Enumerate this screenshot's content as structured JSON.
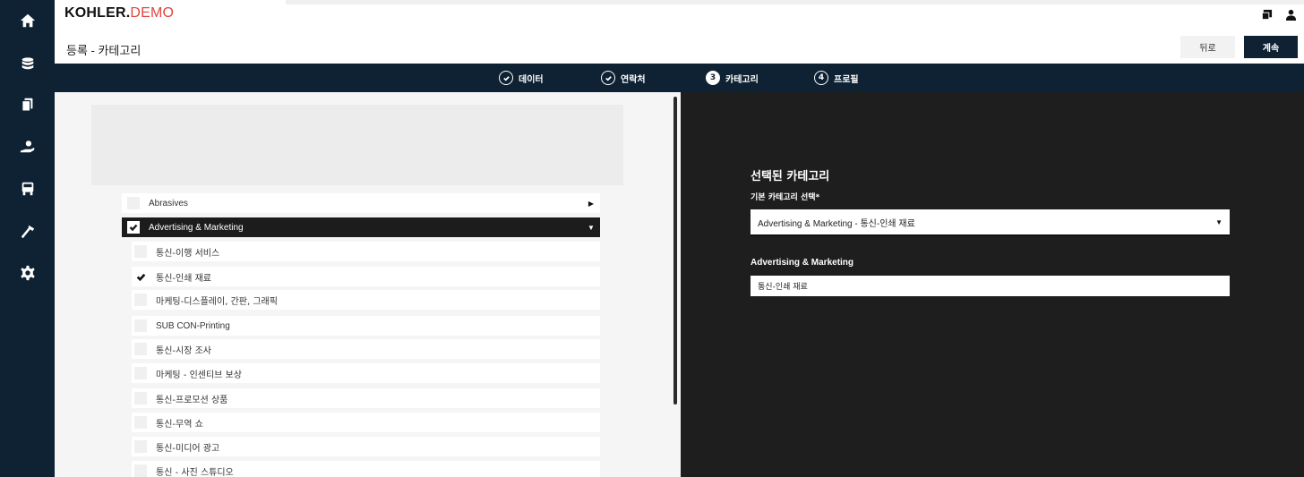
{
  "brand": {
    "bold": "KOHLER.",
    "light": "DEMO"
  },
  "header": {
    "title": "등록 - 카테고리",
    "back_label": "뒤로",
    "next_label": "계속"
  },
  "steps": [
    {
      "label": "데이터",
      "icon": "check-circle-icon"
    },
    {
      "label": "연락처",
      "icon": "check-circle-icon"
    },
    {
      "label": "카테고리",
      "number": "3",
      "active": true
    },
    {
      "label": "프로필",
      "number": "4"
    }
  ],
  "rail_icons": [
    "home-icon",
    "database-icon",
    "documents-icon",
    "hand-user-icon",
    "truck-icon",
    "hammer-icon",
    "gear-icon"
  ],
  "categories": {
    "parents": [
      {
        "label": "Abrasives",
        "checked": false,
        "expanded": false
      },
      {
        "label": "Advertising & Marketing",
        "checked": true,
        "expanded": true
      }
    ],
    "children": [
      {
        "label": "통신-이행 서비스",
        "checked": false
      },
      {
        "label": "통신-인쇄 재료",
        "checked": true
      },
      {
        "label": "마케팅-디스플레이, 간판, 그래픽",
        "checked": false
      },
      {
        "label": "SUB CON-Printing",
        "checked": false
      },
      {
        "label": "통신-시장 조사",
        "checked": false
      },
      {
        "label": "마케팅 - 인센티브 보상",
        "checked": false
      },
      {
        "label": "통신-프로모션 상품",
        "checked": false
      },
      {
        "label": "통신-무역 쇼",
        "checked": false
      },
      {
        "label": "통신-미디어 광고",
        "checked": false
      },
      {
        "label": "통신 - 사진 스튜디오",
        "checked": false
      }
    ]
  },
  "selected": {
    "heading": "선택된 카테고리",
    "primary_label": "기본 카테고리 선택*",
    "primary_value": "Advertising & Marketing - 통신-인쇄 재료",
    "group_label": "Advertising & Marketing",
    "chip": "통신-인쇄 재료"
  },
  "colors": {
    "navy": "#0e2233",
    "brand_red": "#e0463d",
    "dark_panel": "#1e1e1e"
  }
}
